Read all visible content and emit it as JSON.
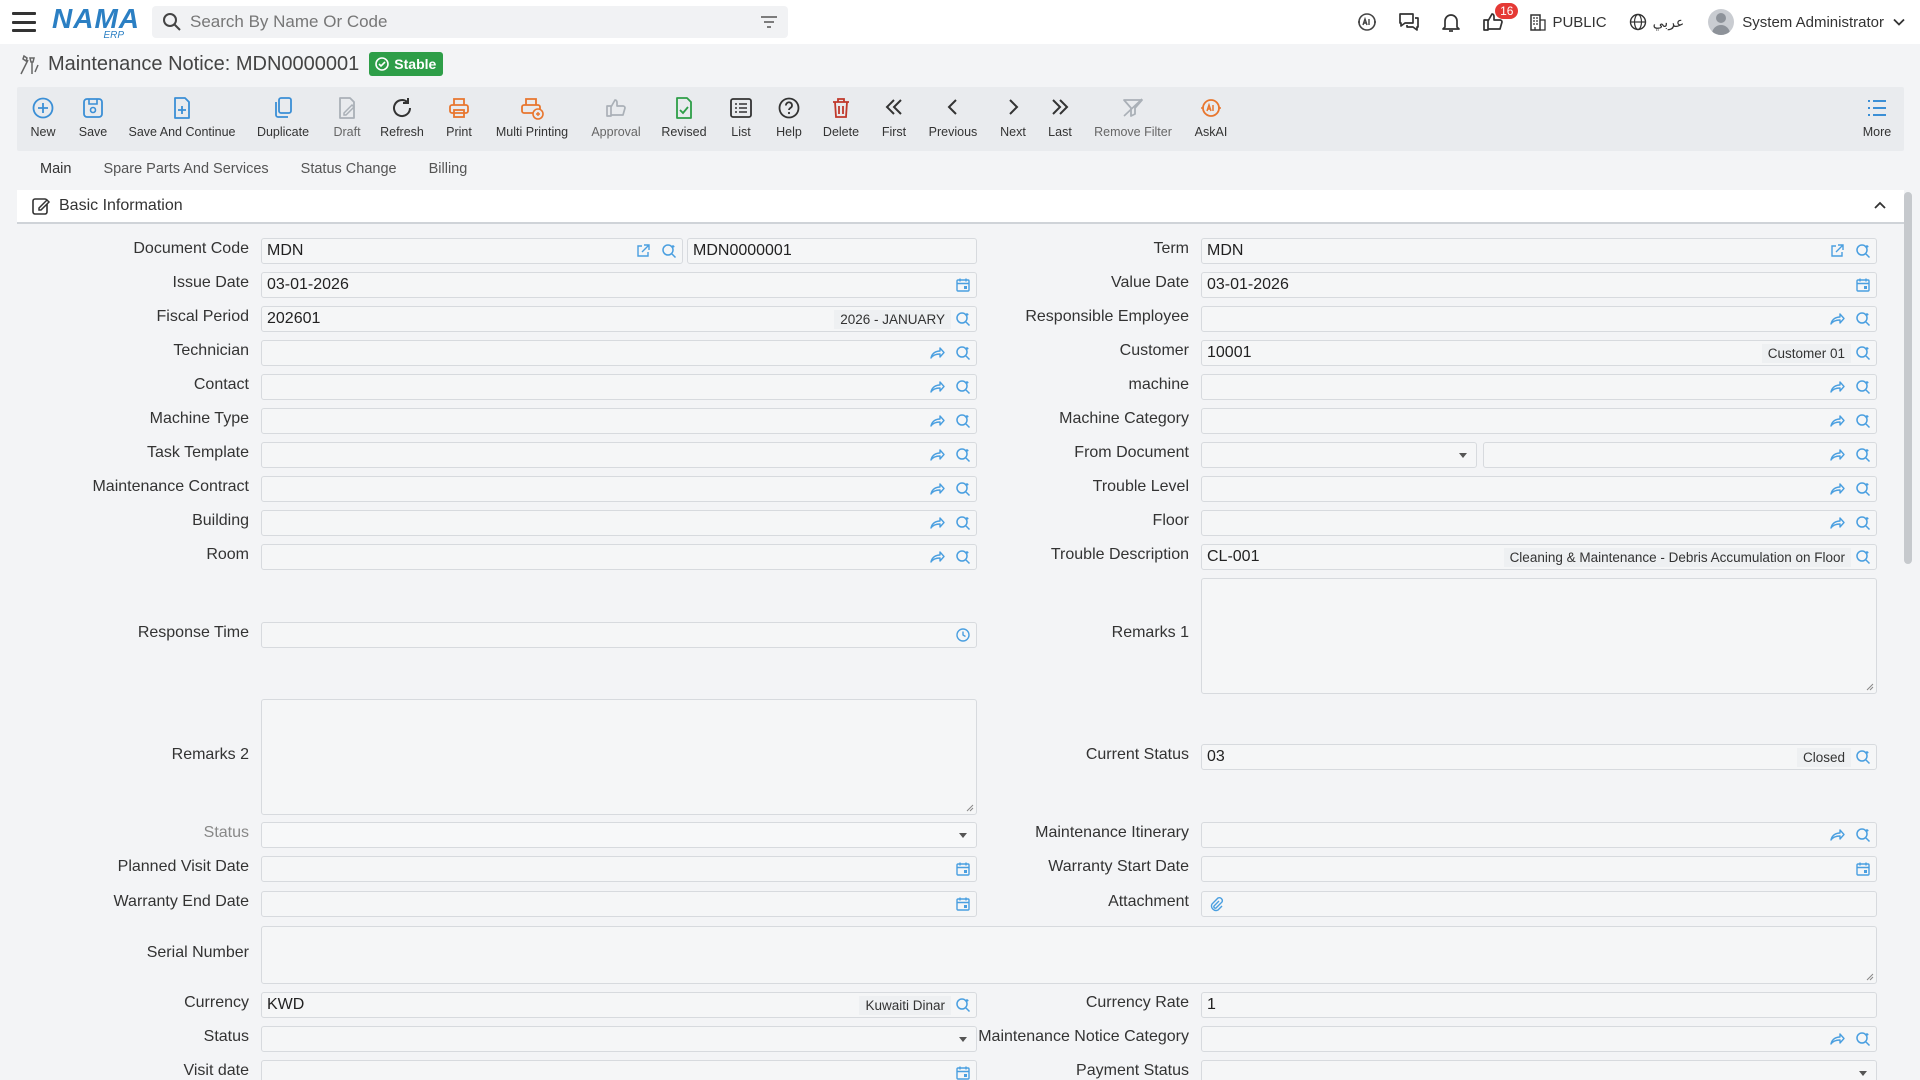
{
  "header": {
    "search_placeholder": "Search By Name Or Code",
    "notification_count": "16",
    "public_label": "PUBLIC",
    "language_label": "عربي",
    "user_name": "System Administrator"
  },
  "title": {
    "text": "Maintenance Notice: MDN0000001",
    "status": "Stable"
  },
  "toolbar": {
    "new": "New",
    "save": "Save",
    "save_continue": "Save And Continue",
    "duplicate": "Duplicate",
    "draft": "Draft",
    "refresh": "Refresh",
    "print": "Print",
    "multi_printing": "Multi Printing",
    "approval": "Approval",
    "revised": "Revised",
    "list": "List",
    "help": "Help",
    "delete": "Delete",
    "first": "First",
    "previous": "Previous",
    "next": "Next",
    "last": "Last",
    "remove_filter": "Remove Filter",
    "askai": "AskAI",
    "more": "More"
  },
  "tabs": [
    "Main",
    "Spare Parts And Services",
    "Status Change",
    "Billing"
  ],
  "section_title": "Basic Information",
  "labels": {
    "document_code": "Document Code",
    "issue_date": "Issue Date",
    "fiscal_period": "Fiscal Period",
    "technician": "Technician",
    "contact": "Contact",
    "machine_type": "Machine Type",
    "task_template": "Task Template",
    "maintenance_contract": "Maintenance Contract",
    "building": "Building",
    "room": "Room",
    "response_time": "Response Time",
    "remarks2": "Remarks 2",
    "status_l": "Status",
    "planned_visit_date": "Planned Visit Date",
    "warranty_end_date": "Warranty End Date",
    "serial_number": "Serial Number",
    "currency": "Currency",
    "status2": "Status",
    "visit_date": "Visit date",
    "term": "Term",
    "value_date": "Value Date",
    "responsible_employee": "Responsible Employee",
    "customer": "Customer",
    "machine": "machine",
    "machine_category": "Machine Category",
    "from_document": "From Document",
    "trouble_level": "Trouble Level",
    "floor": "Floor",
    "trouble_description": "Trouble Description",
    "remarks1": "Remarks 1",
    "current_status": "Current Status",
    "maintenance_itinerary": "Maintenance Itinerary",
    "warranty_start_date": "Warranty Start Date",
    "attachment": "Attachment",
    "currency_rate": "Currency Rate",
    "maintenance_notice_category": "Maintenance Notice Category",
    "payment_status": "Payment Status"
  },
  "values": {
    "document_code": "MDN",
    "document_number": "MDN0000001",
    "issue_date": "03-01-2026",
    "fiscal_period": "202601",
    "fiscal_period_desc": "2026 - JANUARY",
    "term": "MDN",
    "value_date": "03-01-2026",
    "customer": "10001",
    "customer_desc": "Customer 01",
    "trouble_description": "CL-001",
    "trouble_description_desc": "Cleaning & Maintenance - Debris Accumulation on Floor",
    "current_status": "03",
    "current_status_desc": "Closed",
    "currency": "KWD",
    "currency_desc": "Kuwaiti Dinar",
    "currency_rate": "1"
  }
}
